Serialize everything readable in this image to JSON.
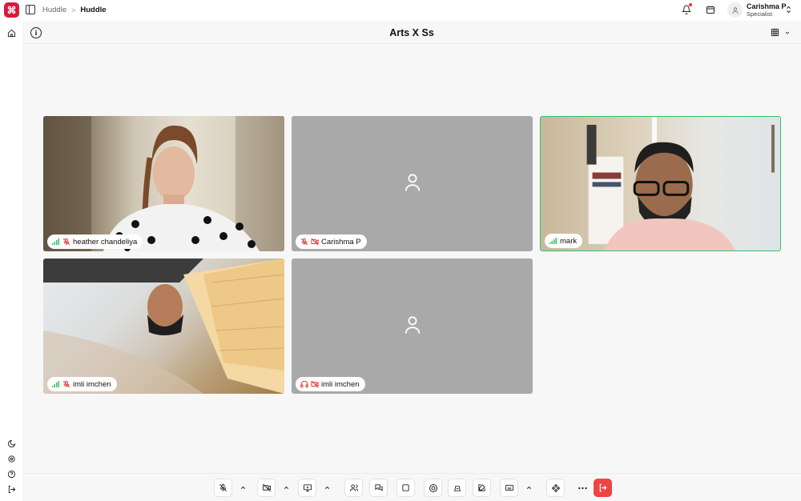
{
  "header": {
    "logo_glyph": "⌘",
    "breadcrumb": [
      "Huddle",
      "Huddle"
    ],
    "breadcrumb_sep": ">",
    "user": {
      "name": "Carishma P",
      "role": "Specialist"
    },
    "icons": [
      "bell-icon",
      "calendar-icon",
      "user-icon",
      "chevron-updown-icon"
    ]
  },
  "left_rail": {
    "icons": [
      "home-icon",
      "moon-icon",
      "settings-icon",
      "help-icon",
      "logout-icon"
    ]
  },
  "meeting": {
    "title": "Arts X Ss",
    "layout_icon": "grid-icon"
  },
  "participants": [
    {
      "name": "heather chandeliya",
      "video": true,
      "mic": "muted",
      "signal": "good",
      "active": false
    },
    {
      "name": "Carishma P",
      "video": false,
      "mic": "muted",
      "cam": "off",
      "active": false
    },
    {
      "name": "mark",
      "video": true,
      "mic": "on",
      "signal": "good",
      "active": true
    },
    {
      "name": "imli imchen",
      "video": true,
      "mic": "muted",
      "signal": "good",
      "active": false
    },
    {
      "name": "imli imchen",
      "video": false,
      "mic": "headphones",
      "cam": "off",
      "active": false
    }
  ],
  "toolbar": {
    "buttons": [
      "mic-off-icon",
      "chevron-up-icon",
      "camera-off-icon",
      "chevron-up-icon",
      "screen-share-icon",
      "chevron-up-icon",
      "participants-icon",
      "chat-icon",
      "whiteboard-icon",
      "record-icon",
      "stage-icon",
      "notes-icon",
      "captions-icon",
      "chevron-up-icon",
      "apps-icon",
      "more-icon",
      "leave-icon"
    ]
  },
  "colors": {
    "brand": "#d81b3c",
    "active_speaker": "#2ec26b",
    "leave": "#ef4444",
    "muted": "#e53935",
    "placeholder_tile": "#a9a9a9"
  }
}
